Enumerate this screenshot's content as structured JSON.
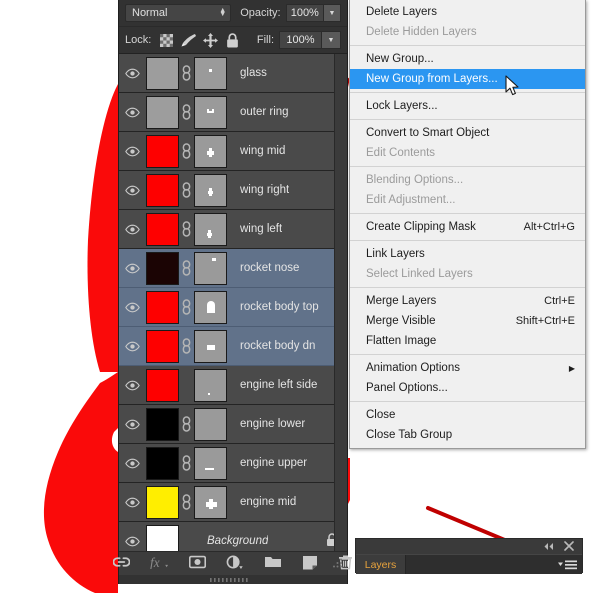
{
  "app": {
    "panel_title": "Layers"
  },
  "options_bar": {
    "blend_mode": "Normal",
    "opacity_label": "Opacity:",
    "opacity_value": "100%",
    "lock_label": "Lock:",
    "fill_label": "Fill:",
    "fill_value": "100%",
    "lock_icons": [
      "transparency-lock-icon",
      "brush-lock-icon",
      "move-lock-icon",
      "all-lock-icon"
    ]
  },
  "layers": [
    {
      "name": "glass",
      "visible": true,
      "thumb_color": "#9d9d9d",
      "mask_shape": "dot",
      "selected": false,
      "locked": false,
      "linked": true
    },
    {
      "name": "outer ring",
      "visible": true,
      "thumb_color": "#9d9d9d",
      "mask_shape": "arc",
      "selected": false,
      "locked": false,
      "linked": true
    },
    {
      "name": "wing mid",
      "visible": true,
      "thumb_color": "#fe0000",
      "mask_shape": "wing-mid",
      "selected": false,
      "locked": false,
      "linked": true
    },
    {
      "name": "wing right",
      "visible": true,
      "thumb_color": "#fe0000",
      "mask_shape": "wing-right",
      "selected": false,
      "locked": false,
      "linked": true
    },
    {
      "name": "wing left",
      "visible": true,
      "thumb_color": "#fe0000",
      "mask_shape": "wing-left",
      "selected": false,
      "locked": false,
      "linked": true
    },
    {
      "name": "rocket nose",
      "visible": true,
      "thumb_color": "#1b0404",
      "mask_shape": "nose",
      "selected": true,
      "locked": false,
      "linked": true
    },
    {
      "name": "rocket body top",
      "visible": true,
      "thumb_color": "#fe0000",
      "mask_shape": "body-top",
      "selected": true,
      "locked": false,
      "linked": true
    },
    {
      "name": "rocket body dn",
      "visible": true,
      "thumb_color": "#fe0000",
      "mask_shape": "body-dn",
      "selected": true,
      "locked": false,
      "linked": true
    },
    {
      "name": "engine left side",
      "visible": true,
      "thumb_color": "#fe0000",
      "mask_shape": "tiny-dot",
      "selected": false,
      "locked": false,
      "linked": false
    },
    {
      "name": "engine lower",
      "visible": true,
      "thumb_color": "#000000",
      "mask_shape": "none",
      "selected": false,
      "locked": false,
      "linked": true
    },
    {
      "name": "engine upper",
      "visible": true,
      "thumb_color": "#000000",
      "mask_shape": "bar",
      "selected": false,
      "locked": false,
      "linked": true
    },
    {
      "name": "engine mid",
      "visible": true,
      "thumb_color": "#ffee00",
      "mask_shape": "engine-mid",
      "selected": false,
      "locked": false,
      "linked": true
    },
    {
      "name": "Background",
      "visible": true,
      "thumb_color": "#ffffff",
      "mask_shape": "none",
      "selected": false,
      "locked": true,
      "linked": false
    }
  ],
  "panel_footer_icons": [
    "link-layers-icon",
    "layer-styles-fx-icon",
    "layer-mask-icon",
    "adjustment-layer-icon",
    "new-group-icon",
    "new-layer-icon",
    "delete-layer-icon"
  ],
  "context_menu": {
    "items": [
      {
        "label": "Delete Layers",
        "shortcut": "",
        "disabled": false,
        "highlighted": false,
        "submenu": false,
        "sep_after": false
      },
      {
        "label": "Delete Hidden Layers",
        "shortcut": "",
        "disabled": true,
        "highlighted": false,
        "submenu": false,
        "sep_after": true
      },
      {
        "label": "New Group...",
        "shortcut": "",
        "disabled": false,
        "highlighted": false,
        "submenu": false,
        "sep_after": false
      },
      {
        "label": "New Group from Layers...",
        "shortcut": "",
        "disabled": false,
        "highlighted": true,
        "submenu": false,
        "sep_after": true
      },
      {
        "label": "Lock Layers...",
        "shortcut": "",
        "disabled": false,
        "highlighted": false,
        "submenu": false,
        "sep_after": true
      },
      {
        "label": "Convert to Smart Object",
        "shortcut": "",
        "disabled": false,
        "highlighted": false,
        "submenu": false,
        "sep_after": false
      },
      {
        "label": "Edit Contents",
        "shortcut": "",
        "disabled": true,
        "highlighted": false,
        "submenu": false,
        "sep_after": true
      },
      {
        "label": "Blending Options...",
        "shortcut": "",
        "disabled": true,
        "highlighted": false,
        "submenu": false,
        "sep_after": false
      },
      {
        "label": "Edit Adjustment...",
        "shortcut": "",
        "disabled": true,
        "highlighted": false,
        "submenu": false,
        "sep_after": true
      },
      {
        "label": "Create Clipping Mask",
        "shortcut": "Alt+Ctrl+G",
        "disabled": false,
        "highlighted": false,
        "submenu": false,
        "sep_after": true
      },
      {
        "label": "Link Layers",
        "shortcut": "",
        "disabled": false,
        "highlighted": false,
        "submenu": false,
        "sep_after": false
      },
      {
        "label": "Select Linked Layers",
        "shortcut": "",
        "disabled": true,
        "highlighted": false,
        "submenu": false,
        "sep_after": true
      },
      {
        "label": "Merge Layers",
        "shortcut": "Ctrl+E",
        "disabled": false,
        "highlighted": false,
        "submenu": false,
        "sep_after": false
      },
      {
        "label": "Merge Visible",
        "shortcut": "Shift+Ctrl+E",
        "disabled": false,
        "highlighted": false,
        "submenu": false,
        "sep_after": false
      },
      {
        "label": "Flatten Image",
        "shortcut": "",
        "disabled": false,
        "highlighted": false,
        "submenu": false,
        "sep_after": true
      },
      {
        "label": "Animation Options",
        "shortcut": "",
        "disabled": false,
        "highlighted": false,
        "submenu": true,
        "sep_after": false
      },
      {
        "label": "Panel Options...",
        "shortcut": "",
        "disabled": false,
        "highlighted": false,
        "submenu": false,
        "sep_after": true
      },
      {
        "label": "Close",
        "shortcut": "",
        "disabled": false,
        "highlighted": false,
        "submenu": false,
        "sep_after": false
      },
      {
        "label": "Close Tab Group",
        "shortcut": "",
        "disabled": false,
        "highlighted": false,
        "submenu": false,
        "sep_after": false
      }
    ]
  },
  "mini_panel": {
    "tab_label": "Layers",
    "collapse_icon": "collapse-to-icons-icon",
    "close_icon": "close-icon",
    "menu_icon": "panel-menu-icon"
  },
  "annotations": {
    "accent_color": "#e00000",
    "arrow_menu_to_layers": "red-arrow-pointing-from-new-group-from-layers-to-selected-layers",
    "arrow_to_panel_menu": "red-arrow-pointing-to-panel-menu-button",
    "left_shape": "red-rocket-illustration-partial"
  }
}
